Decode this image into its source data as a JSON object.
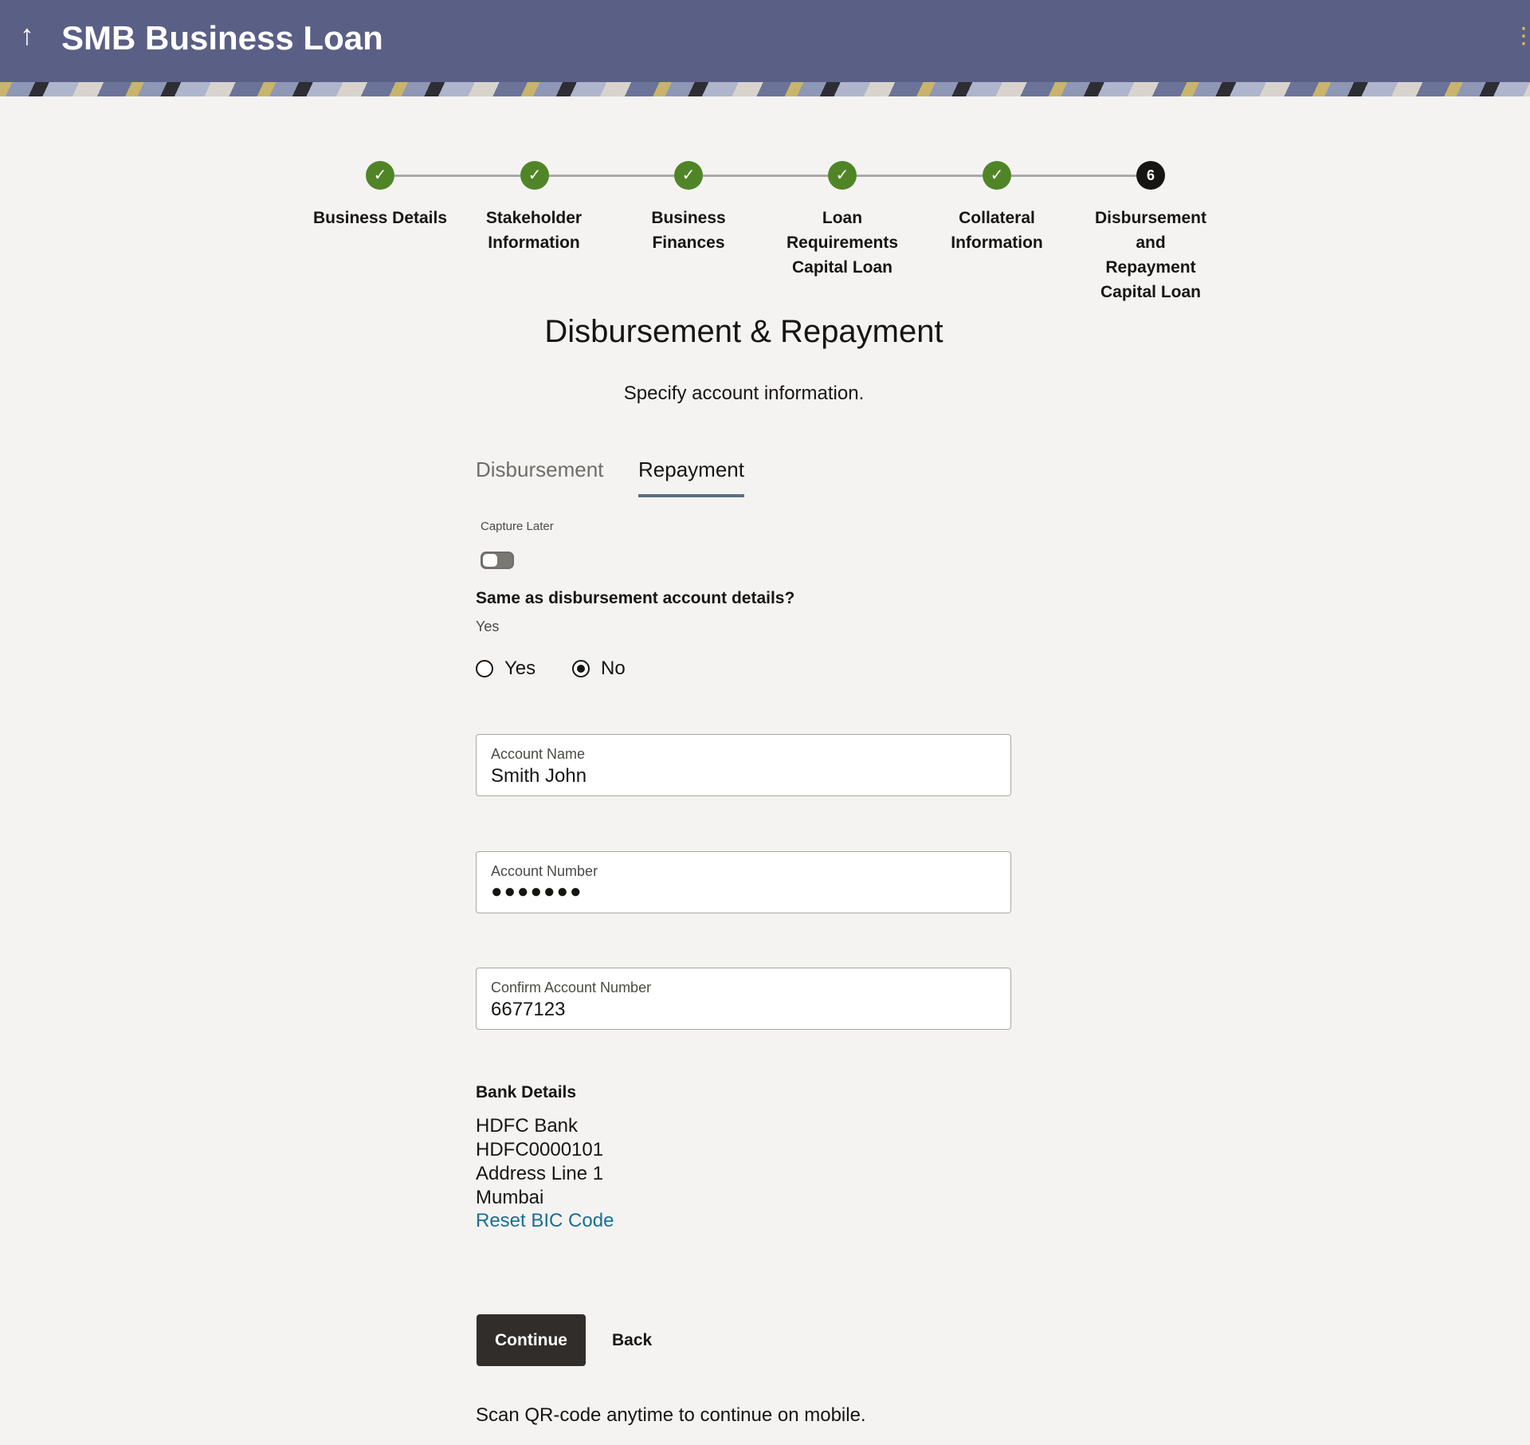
{
  "header": {
    "back_icon": "↑",
    "title": "SMB Business Loan",
    "menu_icon": "⋮"
  },
  "stepper": {
    "steps": [
      {
        "label": "Business Details",
        "state": "complete",
        "marker": "✓"
      },
      {
        "label": "Stakeholder Information",
        "state": "complete",
        "marker": "✓"
      },
      {
        "label": "Business Finances",
        "state": "complete",
        "marker": "✓"
      },
      {
        "label": "Loan Requirements Capital Loan",
        "state": "complete",
        "marker": "✓"
      },
      {
        "label": "Collateral Information",
        "state": "complete",
        "marker": "✓"
      },
      {
        "label": "Disbursement and Repayment Capital Loan",
        "state": "current",
        "marker": "6"
      }
    ]
  },
  "page": {
    "heading": "Disbursement & Repayment",
    "subheading": "Specify account information."
  },
  "tabs": [
    {
      "label": "Disbursement",
      "active": false
    },
    {
      "label": "Repayment",
      "active": true
    }
  ],
  "capture_later": {
    "label": "Capture Later",
    "enabled": false
  },
  "same_as_disbursement": {
    "question": "Same as disbursement account details?",
    "value": "Yes",
    "options": [
      "Yes",
      "No"
    ],
    "selected": "No"
  },
  "fields": {
    "account_name": {
      "label": "Account Name",
      "value": "Smith John"
    },
    "account_number": {
      "label": "Account Number",
      "value": "●●●●●●●"
    },
    "confirm_account_number": {
      "label": "Confirm Account Number",
      "value": "6677123"
    }
  },
  "bank_details": {
    "title": "Bank Details",
    "bank_name": "HDFC Bank",
    "bic_code": "HDFC0000101",
    "address_line": "Address Line 1",
    "city": "Mumbai",
    "reset_link": "Reset BIC Code"
  },
  "actions": {
    "continue": "Continue",
    "back": "Back"
  },
  "footer": {
    "qr_text": "Scan QR-code anytime to continue on mobile."
  },
  "colors": {
    "header_bg": "#5a5f85",
    "step_complete": "#508527",
    "step_current": "#161513",
    "link": "#1a6e95",
    "primary_button": "#312d2a"
  }
}
